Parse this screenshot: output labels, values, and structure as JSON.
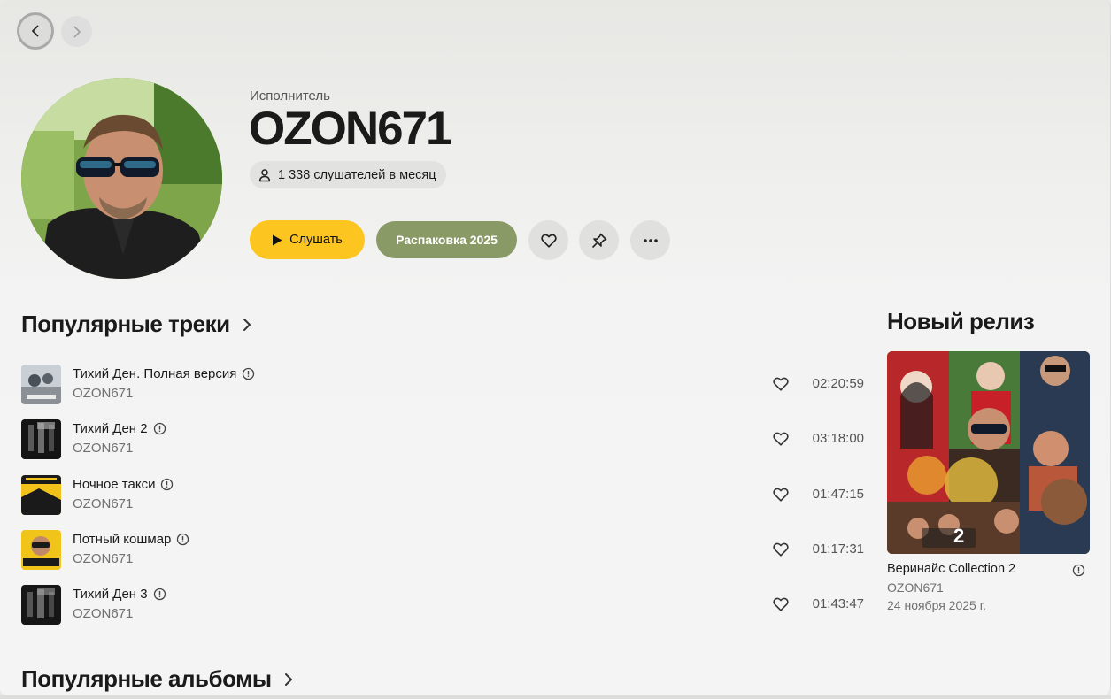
{
  "header": {
    "kind_label": "Исполнитель",
    "artist_name": "OZON671",
    "listeners": "1 338 слушателей в месяц",
    "play_label": "Слушать",
    "unpack_label": "Распаковка 2025"
  },
  "sections": {
    "popular_tracks": "Популярные треки",
    "popular_albums": "Популярные альбомы",
    "new_release": "Новый релиз"
  },
  "tracks": [
    {
      "title": "Тихий Ден. Полная версия",
      "artist": "OZON671",
      "duration": "02:20:59"
    },
    {
      "title": "Тихий Ден 2",
      "artist": "OZON671",
      "duration": "03:18:00"
    },
    {
      "title": "Ночное такси",
      "artist": "OZON671",
      "duration": "01:47:15"
    },
    {
      "title": "Потный кошмар",
      "artist": "OZON671",
      "duration": "01:17:31"
    },
    {
      "title": "Тихий Ден 3",
      "artist": "OZON671",
      "duration": "01:43:47"
    }
  ],
  "new_release": {
    "title": "Веринайс Collection 2",
    "artist": "OZON671",
    "date": "24 ноября 2025 г."
  },
  "colors": {
    "accent_yellow": "#fdc520",
    "unpack_green": "#8a9a66"
  },
  "icons": {
    "nav_back": "chevron-left-icon",
    "nav_forward": "chevron-right-icon",
    "listeners": "person-icon",
    "like": "heart-icon",
    "pin": "pin-icon",
    "more": "more-dots-icon",
    "explicit": "exclamation-circle-icon"
  }
}
